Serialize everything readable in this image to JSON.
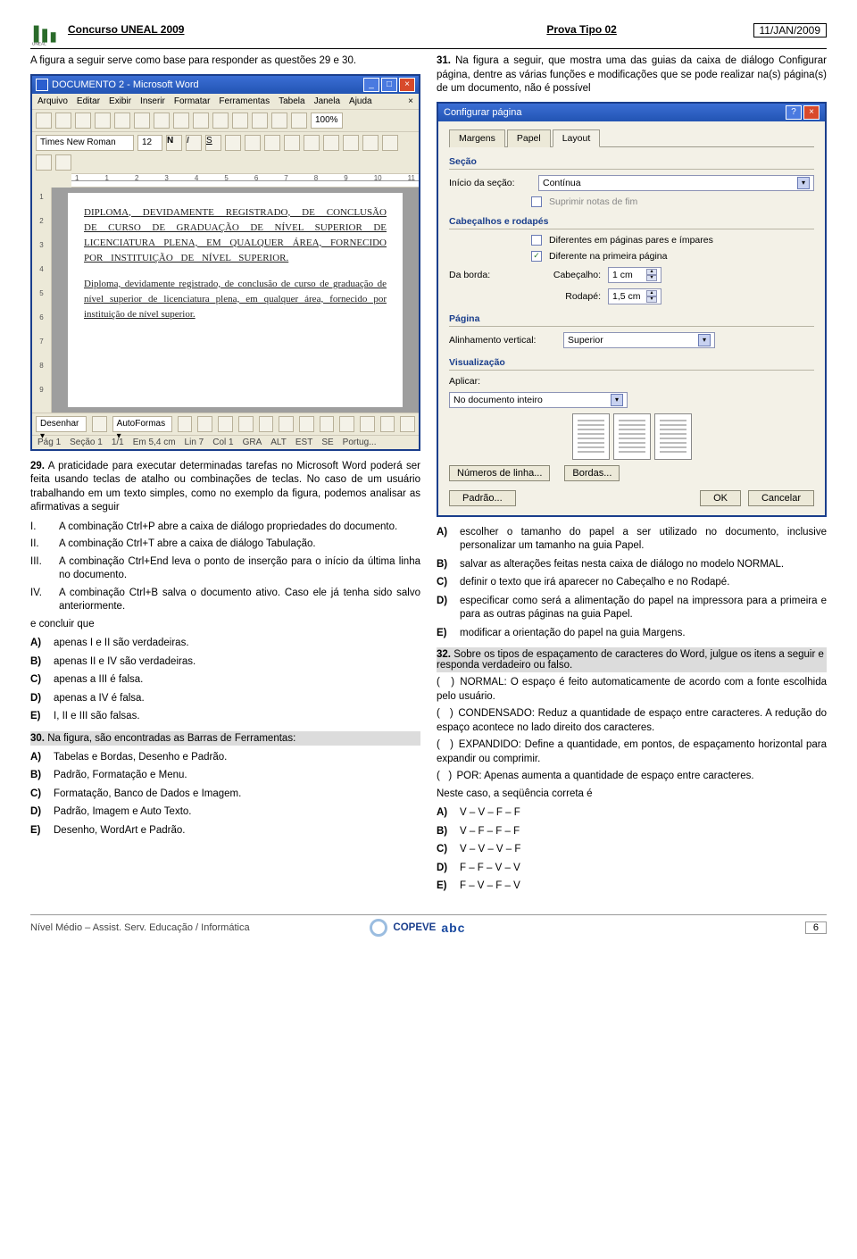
{
  "header": {
    "left": "Concurso UNEAL 2009",
    "center": "Prova Tipo 02",
    "right": "11/JAN/2009"
  },
  "intro29": "A figura a seguir serve como base para responder as questões 29 e 30.",
  "word": {
    "title": "DOCUMENTO 2 - Microsoft Word",
    "menu": [
      "Arquivo",
      "Editar",
      "Exibir",
      "Inserir",
      "Formatar",
      "Ferramentas",
      "Tabela",
      "Janela",
      "Ajuda"
    ],
    "font": "Times New Roman",
    "size": "12",
    "zoom": "100%",
    "ruler": [
      "1",
      "",
      "1",
      "2",
      "3",
      "4",
      "5",
      "6",
      "7",
      "8",
      "9",
      "10",
      "11"
    ],
    "vruler": [
      "1",
      "2",
      "3",
      "4",
      "5",
      "6",
      "7",
      "8",
      "9"
    ],
    "cap": "DIPLOMA, DEVIDAMENTE REGISTRADO, DE CONCLUSÃO DE CURSO DE GRADUAÇÃO DE NÍVEL SUPERIOR DE LICENCIATURA PLENA, EM QUALQUER ÁREA, FORNECIDO POR INSTITUIÇÃO DE NÍVEL SUPERIOR.",
    "low": "Diploma, devidamente registrado, de conclusão de curso de graduação de nível superior de licenciatura plena, em qualquer área, fornecido por instituição de nível superior.",
    "draw": [
      "Desenhar ▾",
      "AutoFormas ▾"
    ],
    "status": [
      "Pág 1",
      "Seção 1",
      "1/1",
      "Em 5,4 cm",
      "Lin 7",
      "Col 1",
      "GRA",
      "ALT",
      "EST",
      "SE",
      "Portug..."
    ]
  },
  "q29": {
    "num": "29.",
    "text": "A praticidade para executar determinadas tarefas no Microsoft Word poderá ser feita usando teclas de atalho ou combinações de teclas. No caso de um usuário trabalhando em um texto simples, como no exemplo da figura, podemos analisar as afirmativas a seguir",
    "roman": [
      {
        "n": "I.",
        "t": "A combinação Ctrl+P abre a caixa de diálogo propriedades do documento."
      },
      {
        "n": "II.",
        "t": "A combinação Ctrl+T abre a caixa de diálogo Tabulação."
      },
      {
        "n": "III.",
        "t": "A combinação Ctrl+End leva o ponto de inserção para o início da última linha no documento."
      },
      {
        "n": "IV.",
        "t": "A combinação Ctrl+B salva o documento ativo. Caso ele já tenha sido salvo anteriormente."
      }
    ],
    "concl": "e concluir que",
    "opts": [
      {
        "l": "A)",
        "t": "apenas I e II são verdadeiras."
      },
      {
        "l": "B)",
        "t": "apenas II e IV são verdadeiras."
      },
      {
        "l": "C)",
        "t": "apenas a III é falsa."
      },
      {
        "l": "D)",
        "t": "apenas a IV é falsa."
      },
      {
        "l": "E)",
        "t": "I, II e III são falsas."
      }
    ]
  },
  "q30": {
    "num": "30.",
    "text": "Na figura, são encontradas as Barras de Ferramentas:",
    "opts": [
      {
        "l": "A)",
        "t": "Tabelas e Bordas, Desenho e Padrão."
      },
      {
        "l": "B)",
        "t": "Padrão, Formatação e Menu."
      },
      {
        "l": "C)",
        "t": "Formatação, Banco de Dados e Imagem."
      },
      {
        "l": "D)",
        "t": "Padrão, Imagem e Auto Texto."
      },
      {
        "l": "E)",
        "t": "Desenho, WordArt e Padrão."
      }
    ]
  },
  "q31intro": {
    "num": "31.",
    "text": "Na figura a seguir, que mostra uma das guias da caixa de diálogo Configurar página, dentre as várias funções e modificações que se pode realizar na(s) página(s) de um documento, não é possível"
  },
  "dlg": {
    "title": "Configurar página",
    "tabs": [
      "Margens",
      "Papel",
      "Layout"
    ],
    "section": {
      "group": "Seção",
      "label": "Início da seção:",
      "value": "Contínua",
      "suppress": "Suprimir notas de fim"
    },
    "headers": {
      "group": "Cabeçalhos e rodapés",
      "opt1": "Diferentes em páginas pares e ímpares",
      "opt2": "Diferente na primeira página",
      "fromedge": "Da borda:",
      "hdr": "Cabeçalho:",
      "hdrv": "1 cm",
      "ftr": "Rodapé:",
      "ftrv": "1,5 cm"
    },
    "page": {
      "group": "Página",
      "label": "Alinhamento vertical:",
      "value": "Superior"
    },
    "preview": {
      "group": "Visualização",
      "apply": "Aplicar:",
      "applyv": "No documento inteiro"
    },
    "links": {
      "lines": "Números de linha...",
      "borders": "Bordas..."
    },
    "default": "Padrão...",
    "ok": "OK",
    "cancel": "Cancelar"
  },
  "q31opts": [
    {
      "l": "A)",
      "t": "escolher o tamanho do papel a ser utilizado no documento, inclusive personalizar um tamanho na guia Papel."
    },
    {
      "l": "B)",
      "t": "salvar as alterações feitas nesta caixa de diálogo no modelo NORMAL."
    },
    {
      "l": "C)",
      "t": "definir o texto que irá aparecer no Cabeçalho e no Rodapé."
    },
    {
      "l": "D)",
      "t": "especificar como será a alimentação do papel na impressora para a primeira e para as outras páginas na guia Papel."
    },
    {
      "l": "E)",
      "t": "modificar a orientação do papel na guia Margens."
    }
  ],
  "q32": {
    "num": "32.",
    "text": "Sobre os tipos de espaçamento de caracteres do Word, julgue os itens a seguir e responda verdadeiro ou falso.",
    "items": [
      "NORMAL: O espaço é feito automaticamente de acordo com a fonte escolhida pelo usuário.",
      "CONDENSADO: Reduz a quantidade de espaço entre caracteres. A redução do espaço acontece no lado direito dos caracteres.",
      "EXPANDIDO: Define a quantidade, em pontos, de espaçamento horizontal para expandir ou comprimir.",
      "POR: Apenas aumenta a quantidade de espaço entre caracteres."
    ],
    "seq": "Neste caso, a seqüência correta é",
    "opts": [
      {
        "l": "A)",
        "t": "V – V – F – F"
      },
      {
        "l": "B)",
        "t": "V – F – F – F"
      },
      {
        "l": "C)",
        "t": "V – V – V – F"
      },
      {
        "l": "D)",
        "t": "F – F – V – V"
      },
      {
        "l": "E)",
        "t": "F – V – F – V"
      }
    ]
  },
  "footer": {
    "text": "Nível Médio – Assist. Serv. Educação / Informática",
    "logo": "COPEVE",
    "page": "6"
  }
}
